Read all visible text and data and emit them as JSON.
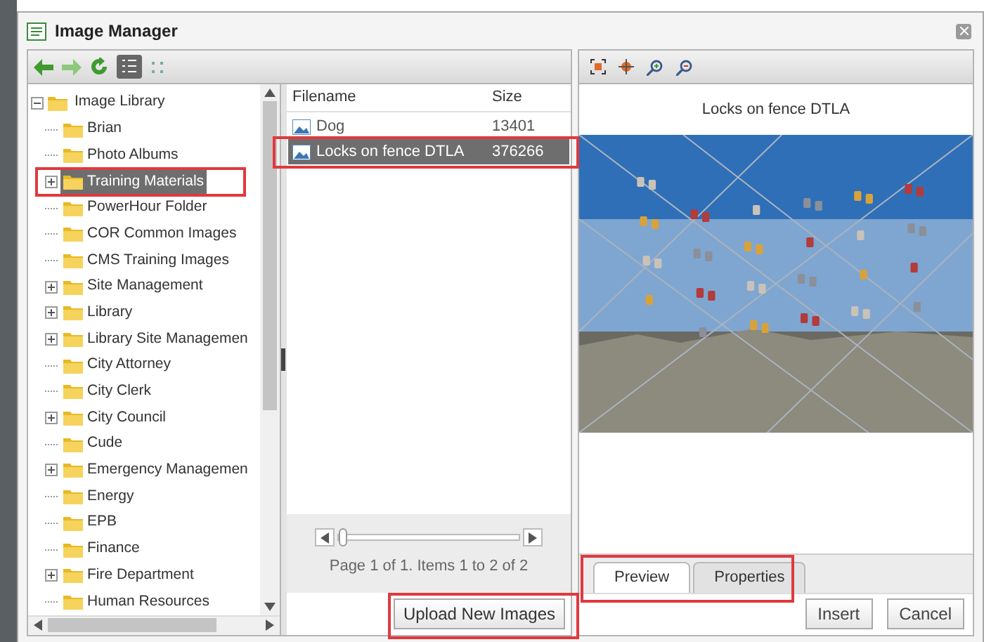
{
  "window": {
    "title": "Image Manager"
  },
  "tree": {
    "root": {
      "label": "Image Library",
      "expanded": true,
      "children": [
        {
          "label": "Brian",
          "expandable": false,
          "selected": false
        },
        {
          "label": "Photo Albums",
          "expandable": false,
          "selected": false
        },
        {
          "label": "Training Materials",
          "expandable": true,
          "selected": true
        },
        {
          "label": "PowerHour Folder",
          "expandable": false,
          "selected": false
        },
        {
          "label": "COR Common Images",
          "expandable": false,
          "selected": false
        },
        {
          "label": "CMS Training Images",
          "expandable": false,
          "selected": false
        },
        {
          "label": "Site Management",
          "expandable": true,
          "selected": false
        },
        {
          "label": "Library",
          "expandable": true,
          "selected": false
        },
        {
          "label": "Library Site Managemen",
          "expandable": true,
          "selected": false
        },
        {
          "label": "City Attorney",
          "expandable": false,
          "selected": false
        },
        {
          "label": "City Clerk",
          "expandable": false,
          "selected": false
        },
        {
          "label": "City Council",
          "expandable": true,
          "selected": false
        },
        {
          "label": "Cude",
          "expandable": false,
          "selected": false
        },
        {
          "label": "Emergency Managemen",
          "expandable": true,
          "selected": false
        },
        {
          "label": "Energy",
          "expandable": false,
          "selected": false
        },
        {
          "label": "EPB",
          "expandable": false,
          "selected": false
        },
        {
          "label": "Finance",
          "expandable": false,
          "selected": false
        },
        {
          "label": "Fire Department",
          "expandable": true,
          "selected": false
        },
        {
          "label": "Human Resources",
          "expandable": false,
          "selected": false
        }
      ]
    }
  },
  "files": {
    "columns": [
      "Filename",
      "Size"
    ],
    "rows": [
      {
        "name": "Dog",
        "size": "13401",
        "selected": false
      },
      {
        "name": "Locks on fence DTLA",
        "size": "376266",
        "selected": true
      }
    ],
    "pager": {
      "level": 0,
      "text": "Page 1 of 1. Items 1 to 2 of 2"
    },
    "upload_button": "Upload New Images"
  },
  "preview": {
    "title": "Locks on fence DTLA",
    "tabs": [
      {
        "label": "Preview",
        "selected": true
      },
      {
        "label": "Properties",
        "selected": false
      }
    ],
    "buttons": [
      "Insert",
      "Cancel"
    ]
  }
}
